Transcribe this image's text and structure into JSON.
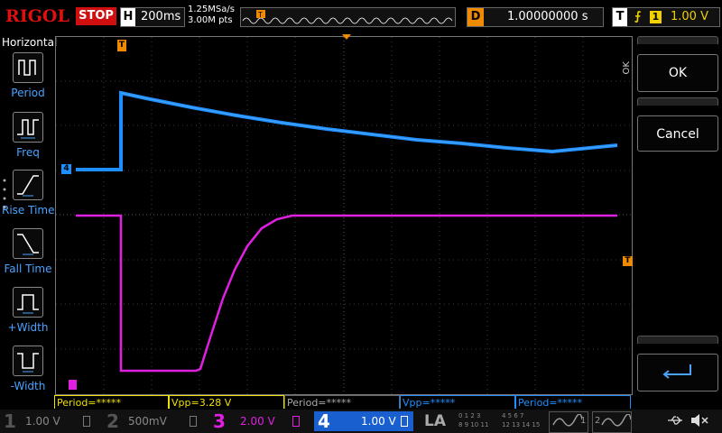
{
  "topbar": {
    "logo": "RIGOL",
    "run_state": "STOP",
    "horizontal_label": "H",
    "timebase": "200ms",
    "sample_rate": "1.25MSa/s",
    "memory_depth": "3.00M pts",
    "trigger_marker": "T",
    "delay_label": "D",
    "delay_value": "1.00000000 s",
    "trigger_label": "T",
    "trigger_edge": "⨍",
    "trigger_source": "1",
    "trigger_level": "1.00 V"
  },
  "left_menu": {
    "title": "Horizontal",
    "items": [
      {
        "label": "Period"
      },
      {
        "label": "Freq"
      },
      {
        "label": "Rise Time"
      },
      {
        "label": "Fall Time"
      },
      {
        "label": "+Width"
      },
      {
        "label": "-Width"
      }
    ]
  },
  "right_menu": {
    "ok_side_label": "OK",
    "ok_label": "OK",
    "cancel_label": "Cancel",
    "enter_icon": "enter-icon"
  },
  "markers": {
    "ch4": "4",
    "trigger_top": "T",
    "trigger_right": "T"
  },
  "measurements": [
    {
      "text": "Period=*****",
      "color": "#f0e000"
    },
    {
      "text": "Vpp=3.28 V",
      "color": "#f0e000"
    },
    {
      "text": "Period=*****",
      "color": "#aaaaaa"
    },
    {
      "text": "Vpp=*****",
      "color": "#1f8fff"
    },
    {
      "text": "Period=*****",
      "color": "#1f8fff"
    }
  ],
  "channels": [
    {
      "num": "1",
      "value": "1.00 V",
      "color": "#f0e000"
    },
    {
      "num": "2",
      "value": "500mV",
      "color": "#22c6c6"
    },
    {
      "num": "3",
      "value": "2.00 V",
      "color": "#e020e0"
    },
    {
      "num": "4",
      "value": "1.00 V",
      "color": "#1f8fff"
    }
  ],
  "bottom": {
    "la_label": "LA",
    "digital_bits": [
      "0 1 2 3",
      "4 5 6 7",
      "8 9 10 11",
      "12 13 14 15"
    ],
    "gen1_label": "1",
    "gen2_label": "2"
  },
  "colors": {
    "ch1": "#f0e000",
    "ch2": "#22c6c6",
    "ch3": "#e020e0",
    "ch4": "#1f8fff",
    "trigger": "#f08a00",
    "stop": "#d01010"
  }
}
